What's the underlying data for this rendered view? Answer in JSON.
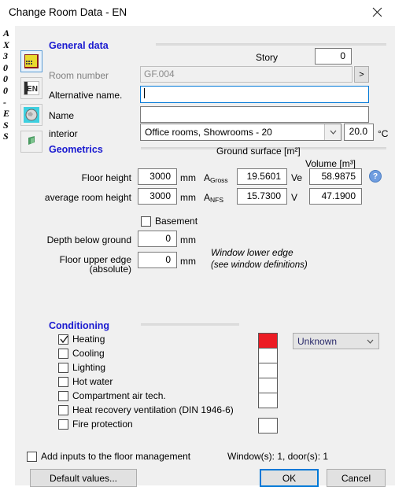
{
  "window": {
    "title": "Change Room Data - EN",
    "close_icon": "close-icon",
    "rail_letters": [
      "A",
      "X",
      "3",
      "0",
      "0",
      "0",
      "-",
      "E",
      "S",
      "S"
    ],
    "icons": [
      {
        "name": "room-icon",
        "selected": true
      },
      {
        "name": "en-language-icon",
        "selected": false
      },
      {
        "name": "globe-icon",
        "selected": false
      },
      {
        "name": "note-icon",
        "selected": false
      }
    ]
  },
  "general": {
    "heading": "General data",
    "story_label": "Story",
    "story_value": "0",
    "room_number_label": "Room number",
    "room_number_value": "GF.004",
    "room_number_button": ">",
    "alt_name_label": "Alternative name.",
    "alt_name_value": "",
    "name_label": "Name",
    "name_value": "",
    "interior_label": "interior",
    "interior_value": "Office rooms, Showrooms - 20",
    "temperature_value": "20.0",
    "temperature_unit": "°C"
  },
  "geometrics": {
    "heading": "Geometrics",
    "ground_surface_label": "Ground surface [m²]",
    "volume_label": "Volume [m³]",
    "floor_height_label": "Floor height",
    "floor_height_value": "3000",
    "floor_height_unit": "mm",
    "avg_room_height_label": "average room height",
    "avg_room_height_value": "3000",
    "avg_room_height_unit": "mm",
    "a_gross_label": "A",
    "a_gross_sub": "Gross",
    "a_gross_value": "19.5601",
    "a_nfs_label": "A",
    "a_nfs_sub": "NFS",
    "a_nfs_value": "15.7300",
    "ve_label": "Ve",
    "ve_value": "58.9875",
    "v_label": "V",
    "v_value": "47.1900",
    "help_icon": "?",
    "basement_label": "Basement",
    "basement_checked": false,
    "depth_below_ground_label": "Depth below ground",
    "depth_below_ground_value": "0",
    "depth_below_ground_unit": "mm",
    "floor_upper_edge_label": "Floor upper edge",
    "floor_upper_edge_label2": "(absolute)",
    "floor_upper_edge_value": "0",
    "floor_upper_edge_unit": "mm",
    "window_lower_edge_label": "Window lower edge",
    "window_lower_edge_note": "(see window definitions)"
  },
  "conditioning": {
    "heading": "Conditioning",
    "dropdown_value": "Unknown",
    "rows": [
      {
        "label": "Heating",
        "checked": true,
        "swatch": "#ec1c24",
        "has_swatch": true
      },
      {
        "label": "Cooling",
        "checked": false,
        "swatch": "#ffffff",
        "has_swatch": true
      },
      {
        "label": "Lighting",
        "checked": false,
        "swatch": "#ffffff",
        "has_swatch": true
      },
      {
        "label": "Hot water",
        "checked": false,
        "swatch": "#ffffff",
        "has_swatch": true
      },
      {
        "label": "Compartment air tech.",
        "checked": false,
        "swatch": "#ffffff",
        "has_swatch": true
      },
      {
        "label": "Heat recovery ventilation (DIN 1946-6)",
        "checked": false,
        "swatch": "",
        "has_swatch": false
      },
      {
        "label": "Fire protection",
        "checked": false,
        "swatch": "#ffffff",
        "has_swatch": true
      }
    ]
  },
  "footer": {
    "add_inputs_label": "Add inputs to the floor management",
    "add_inputs_checked": false,
    "counts_label": "Window(s): 1, door(s): 1",
    "default_values_label": "Default values...",
    "ok_label": "OK",
    "cancel_label": "Cancel"
  }
}
